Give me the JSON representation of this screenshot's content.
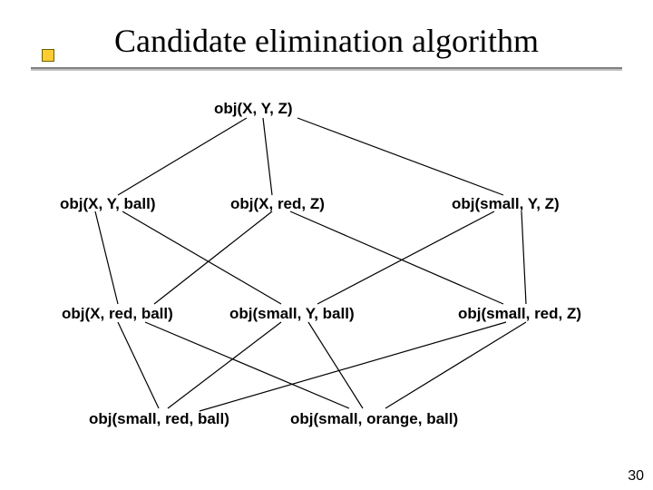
{
  "title": "Candidate elimination algorithm",
  "page_number": "30",
  "nodes": {
    "top": {
      "label": "obj(X, Y, Z)"
    },
    "m1": {
      "label": "obj(X, Y, ball)"
    },
    "m2": {
      "label": "obj(X, red, Z)"
    },
    "m3": {
      "label": "obj(small, Y, Z)"
    },
    "l1": {
      "label": "obj(X, red, ball)"
    },
    "l2": {
      "label": "obj(small, Y, ball)"
    },
    "l3": {
      "label": "obj(small, red, Z)"
    },
    "b1": {
      "label": "obj(small, red, ball)"
    },
    "b2": {
      "label": "obj(small, orange, ball)"
    }
  }
}
